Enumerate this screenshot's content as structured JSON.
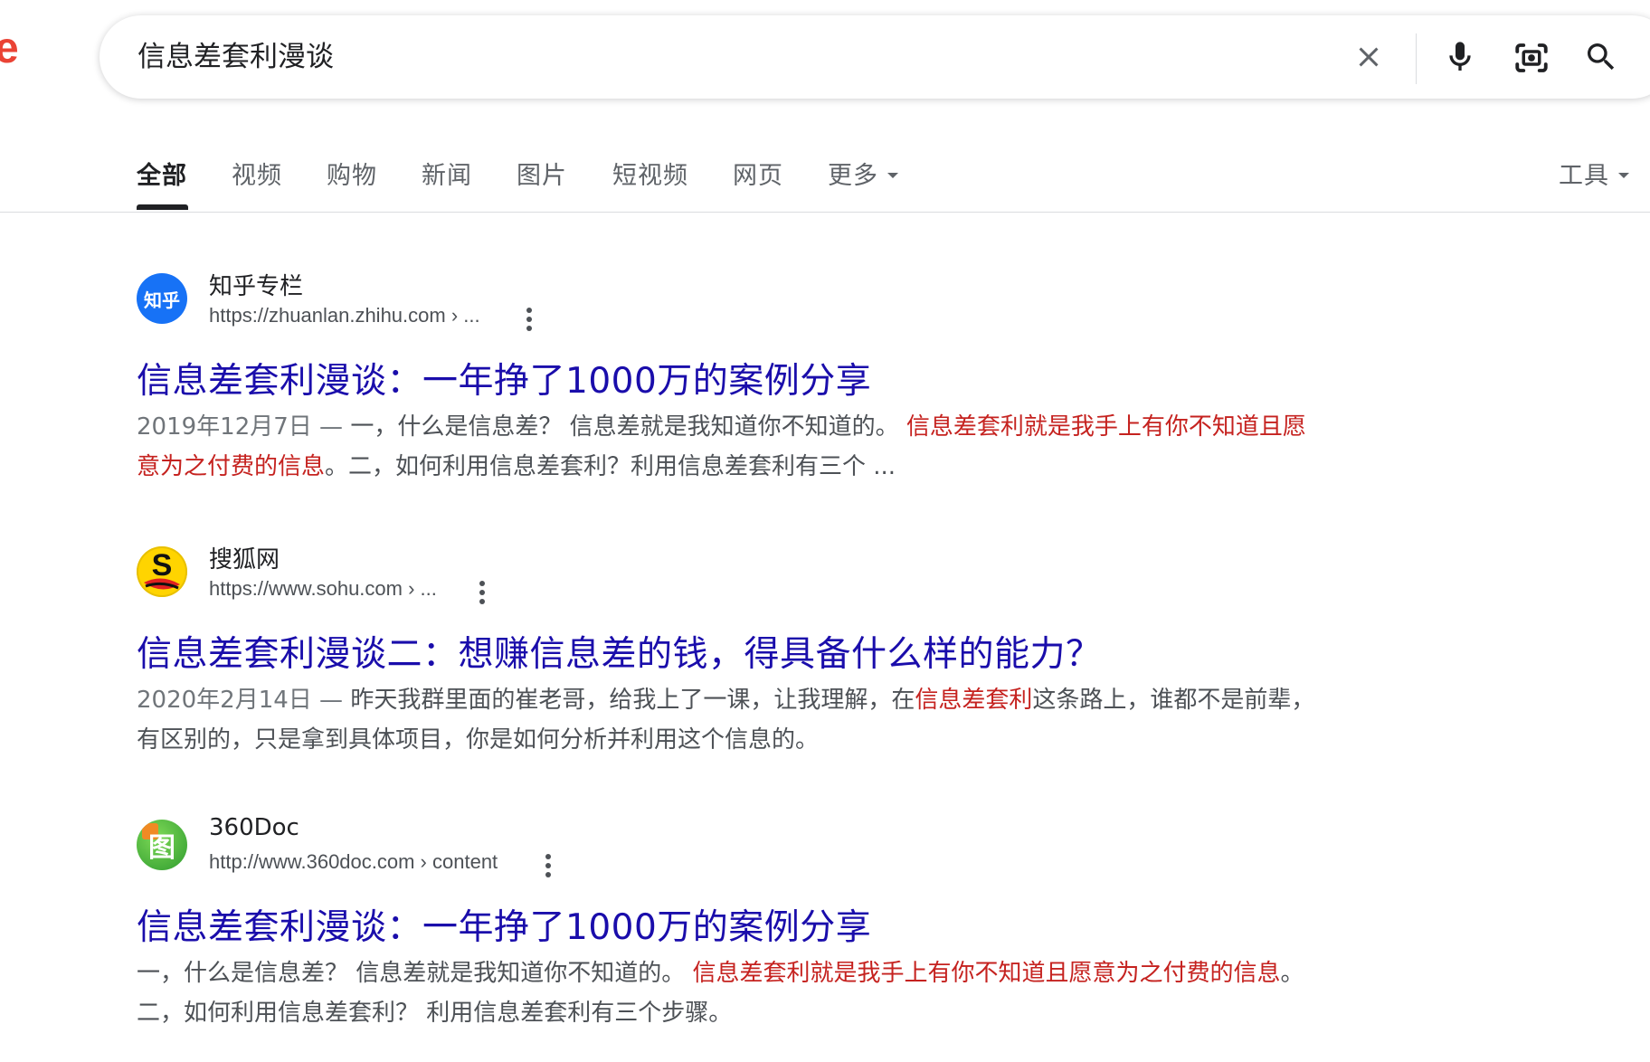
{
  "logo": {
    "fragment": "e"
  },
  "search": {
    "query": "信息差套利漫谈"
  },
  "tabs": [
    {
      "label": "全部"
    },
    {
      "label": "视频"
    },
    {
      "label": "购物"
    },
    {
      "label": "新闻"
    },
    {
      "label": "图片"
    },
    {
      "label": "短视频"
    },
    {
      "label": "网页"
    },
    {
      "label": "更多"
    }
  ],
  "tools_label": "工具",
  "results": [
    {
      "site_name": "知乎专栏",
      "url": "https://zhuanlan.zhihu.com › ...",
      "favicon_text": "知乎",
      "title": "信息差套利漫谈：一年挣了1000万的案例分享",
      "snippet": {
        "date": "2019年12月7日 — ",
        "part1": "一，什么是信息差？ 信息差就是我知道你不知道的。 ",
        "highlight": "信息差套利就是我手上有你不知道且愿意为之付费的信息",
        "part2": "。二，如何利用信息差套利？利用信息差套利有三个 ..."
      }
    },
    {
      "site_name": "搜狐网",
      "url": "https://www.sohu.com › ...",
      "favicon_text": "S",
      "title": "信息差套利漫谈二：想赚信息差的钱，得具备什么样的能力？",
      "snippet": {
        "date": "2020年2月14日 — ",
        "part1": "昨天我群里面的崔老哥，给我上了一课，让我理解，在",
        "highlight": "信息差套利",
        "part2": "这条路上，谁都不是前辈，有区别的，只是拿到具体项目，你是如何分析并利用这个信息的。"
      }
    },
    {
      "site_name": "360Doc",
      "url": "http://www.360doc.com › content",
      "favicon_text": "图",
      "title": "信息差套利漫谈：一年挣了1000万的案例分享",
      "snippet": {
        "date": "",
        "part1": "一，什么是信息差？ 信息差就是我知道你不知道的。 ",
        "highlight": "信息差套利就是我手上有你不知道且愿意为之付费的信息",
        "part2": "。 二，如何利用信息差套利？ 利用信息差套利有三个步骤。"
      }
    }
  ],
  "colors": {
    "link": "#1a0dab",
    "highlight": "#c5221f",
    "logo_red": "#ea4335"
  }
}
